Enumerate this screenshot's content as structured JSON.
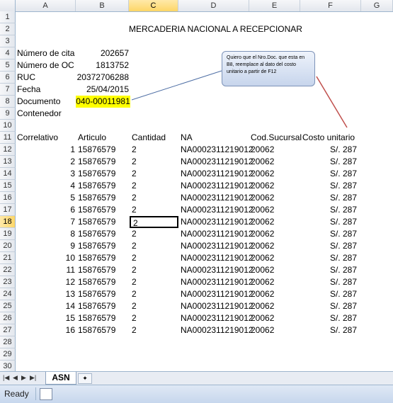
{
  "columns": [
    "A",
    "B",
    "C",
    "D",
    "E",
    "F",
    "G"
  ],
  "rows": [
    "1",
    "2",
    "3",
    "4",
    "5",
    "6",
    "7",
    "8",
    "9",
    "10",
    "11",
    "12",
    "13",
    "14",
    "15",
    "16",
    "17",
    "18",
    "19",
    "20",
    "21",
    "22",
    "23",
    "24",
    "25",
    "26",
    "27",
    "28",
    "29",
    "30"
  ],
  "title": "MERCADERIA NACIONAL A RECEPCIONAR",
  "info": [
    {
      "label": "Número de cita",
      "value": "202657"
    },
    {
      "label": "Número de OC",
      "value": "1813752"
    },
    {
      "label": "RUC",
      "value": "20372706288"
    },
    {
      "label": "Fecha",
      "value": "25/04/2015"
    },
    {
      "label": "Documento",
      "value": "040-00011981"
    },
    {
      "label": "Contenedor",
      "value": ""
    }
  ],
  "table_headers": {
    "correlativo": "Correlativo",
    "articulo": "Articulo",
    "cantidad": "Cantidad",
    "na": "NA",
    "cod": "Cod.Sucursal",
    "costo": "Costo unitario"
  },
  "table_rows": [
    {
      "n": "1",
      "art": "15876579",
      "cant": "2",
      "na": "NA0002311219012",
      "cod": "20062",
      "costo": "S/. 287"
    },
    {
      "n": "2",
      "art": "15876579",
      "cant": "2",
      "na": "NA0002311219012",
      "cod": "20062",
      "costo": "S/. 287"
    },
    {
      "n": "3",
      "art": "15876579",
      "cant": "2",
      "na": "NA0002311219012",
      "cod": "20062",
      "costo": "S/. 287"
    },
    {
      "n": "4",
      "art": "15876579",
      "cant": "2",
      "na": "NA0002311219012",
      "cod": "20062",
      "costo": "S/. 287"
    },
    {
      "n": "5",
      "art": "15876579",
      "cant": "2",
      "na": "NA0002311219012",
      "cod": "20062",
      "costo": "S/. 287"
    },
    {
      "n": "6",
      "art": "15876579",
      "cant": "2",
      "na": "NA0002311219012",
      "cod": "20062",
      "costo": "S/. 287"
    },
    {
      "n": "7",
      "art": "15876579",
      "cant": "2",
      "na": "NA0002311219012",
      "cod": "20062",
      "costo": "S/. 287"
    },
    {
      "n": "8",
      "art": "15876579",
      "cant": "2",
      "na": "NA0002311219012",
      "cod": "20062",
      "costo": "S/. 287"
    },
    {
      "n": "9",
      "art": "15876579",
      "cant": "2",
      "na": "NA0002311219012",
      "cod": "20062",
      "costo": "S/. 287"
    },
    {
      "n": "10",
      "art": "15876579",
      "cant": "2",
      "na": "NA0002311219012",
      "cod": "20062",
      "costo": "S/. 287"
    },
    {
      "n": "11",
      "art": "15876579",
      "cant": "2",
      "na": "NA0002311219012",
      "cod": "20062",
      "costo": "S/. 287"
    },
    {
      "n": "12",
      "art": "15876579",
      "cant": "2",
      "na": "NA0002311219012",
      "cod": "20062",
      "costo": "S/. 287"
    },
    {
      "n": "13",
      "art": "15876579",
      "cant": "2",
      "na": "NA0002311219012",
      "cod": "20062",
      "costo": "S/. 287"
    },
    {
      "n": "14",
      "art": "15876579",
      "cant": "2",
      "na": "NA0002311219012",
      "cod": "20062",
      "costo": "S/. 287"
    },
    {
      "n": "15",
      "art": "15876579",
      "cant": "2",
      "na": "NA0002311219012",
      "cod": "20062",
      "costo": "S/. 287"
    },
    {
      "n": "16",
      "art": "15876579",
      "cant": "2",
      "na": "NA0002311219012",
      "cod": "20062",
      "costo": "S/. 287"
    }
  ],
  "comment": "Quiero que el Nro.Doc. que esta en B8, reemplace al dato del costo unitario a partir de F12",
  "sheet_tab": "ASN",
  "status": "Ready",
  "colors": {
    "highlight": "#ffff00",
    "selection": "#fdd667",
    "arrow": "#c0504d"
  }
}
